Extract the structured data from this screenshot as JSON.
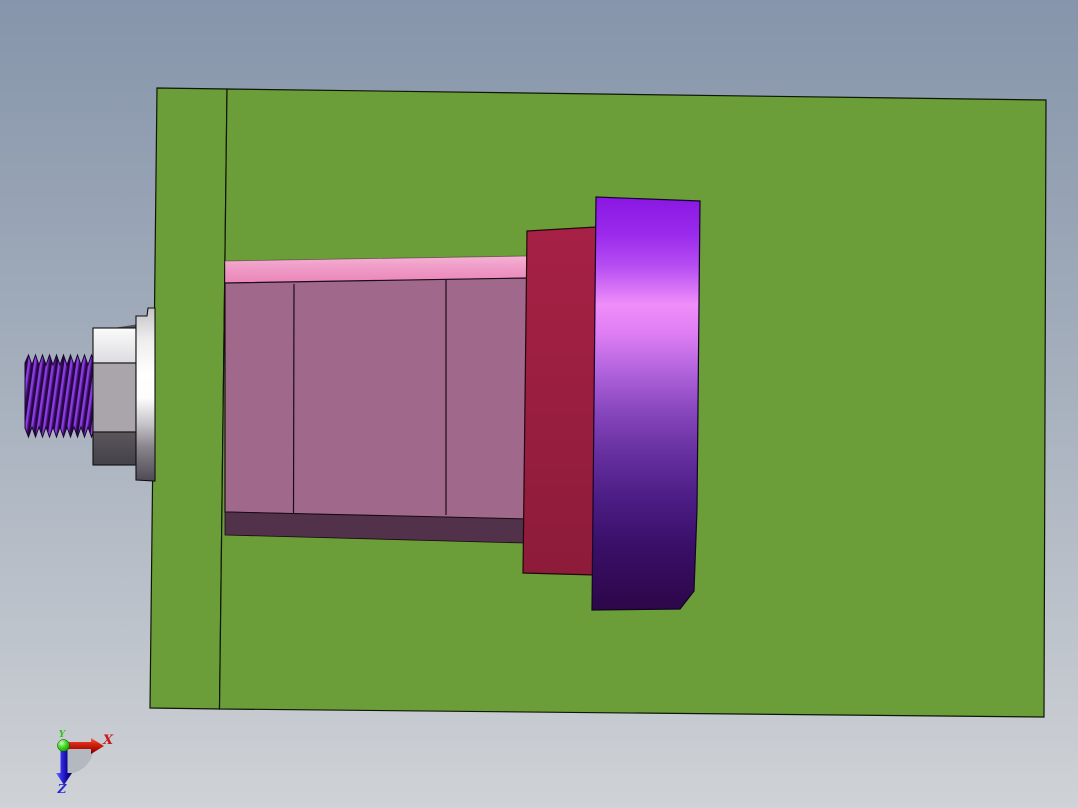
{
  "viewport": {
    "type": "3d-cad-viewport",
    "background_top_color": "#8695ab",
    "background_bottom_color": "#cfd2d6"
  },
  "model": {
    "parts": [
      {
        "name": "base-block",
        "description": "large green base block with recessed left face",
        "color": "#6b9e38"
      },
      {
        "name": "sleeve-cylinder",
        "description": "mauve sleeve cylinder with pink top highlight and dark underside",
        "face_color": "#a0698b",
        "top_highlight_color": "#f09ac6",
        "underside_color": "#52324a"
      },
      {
        "name": "flange-plate",
        "description": "crimson flange plate",
        "color": "#a62145"
      },
      {
        "name": "end-disc",
        "description": "purple end disc with specular highlight band",
        "top_color": "#8a17e2",
        "highlight_color": "#ef8df9",
        "bottom_color": "#2c0748"
      },
      {
        "name": "threaded-bolt",
        "description": "purple threaded stud with gray hex head and washer",
        "thread_light_color": "#8a3ce0",
        "thread_dark_color": "#26073f",
        "head_top_color": "#f2f2f2",
        "head_mid_color": "#a9a5ab",
        "head_bottom_color": "#524e56",
        "washer_color": "#ffffff"
      }
    ]
  },
  "triad": {
    "x": {
      "label": "X",
      "color": "#c8181a"
    },
    "y": {
      "label": "Y",
      "color": "#2ec514"
    },
    "z": {
      "label": "Z",
      "color": "#2a2ad0"
    }
  }
}
